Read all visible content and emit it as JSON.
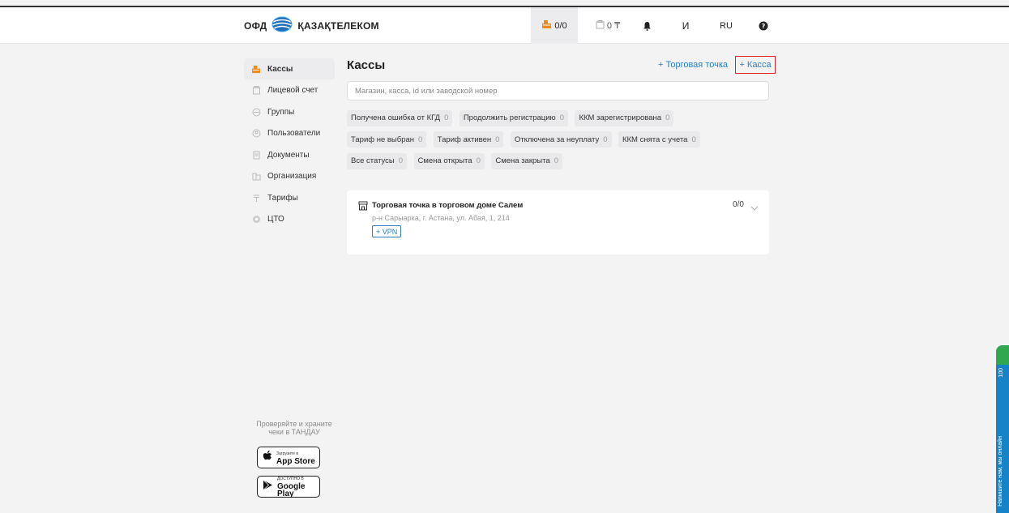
{
  "header": {
    "logo_ofd": "ОФД",
    "logo_name": "ҚАЗАҚТЕЛЕКОМ",
    "kassa_count": "0/0",
    "balance": "0 ₸",
    "user_initial": "И",
    "lang": "RU"
  },
  "sidebar": {
    "items": [
      {
        "label": "Кассы",
        "icon": "cash-register-icon",
        "active": true
      },
      {
        "label": "Лицевой счет",
        "icon": "account-icon"
      },
      {
        "label": "Группы",
        "icon": "groups-icon"
      },
      {
        "label": "Пользователи",
        "icon": "users-icon"
      },
      {
        "label": "Документы",
        "icon": "documents-icon"
      },
      {
        "label": "Организация",
        "icon": "organization-icon"
      },
      {
        "label": "Тарифы",
        "icon": "tariffs-icon"
      },
      {
        "label": "ЦТО",
        "icon": "service-center-icon"
      }
    ],
    "promo_line1": "Проверяйте и храните",
    "promo_line2": "чеки в ТАНДАУ",
    "appstore_small": "Загрузите в",
    "appstore_big": "App Store",
    "gplay_small": "ДОСТУПНО В",
    "gplay_big": "Google Play"
  },
  "main": {
    "title": "Кассы",
    "add_outlet": "+ Торговая точка",
    "add_kassa": "+ Касса",
    "search_placeholder": "Магазин, касса, id или заводской номер",
    "chips": [
      {
        "label": "Получена ошибка от КГД",
        "count": "0"
      },
      {
        "label": "Продолжить регистрацию",
        "count": "0"
      },
      {
        "label": "ККМ зарегистрирована",
        "count": "0"
      },
      {
        "label": "Тариф не выбран",
        "count": "0"
      },
      {
        "label": "Тариф активен",
        "count": "0"
      },
      {
        "label": "Отключена за неуплату",
        "count": "0"
      },
      {
        "label": "ККМ снята с учета",
        "count": "0"
      },
      {
        "label": "Все статусы",
        "count": "0"
      },
      {
        "label": "Смена открыта",
        "count": "0"
      },
      {
        "label": "Смена закрыта",
        "count": "0"
      }
    ]
  },
  "outlet": {
    "title": "Торговая точка в торговом доме Салем",
    "address": "р-н Сарыарка, г. Астана, ул. Абая, 1, 214",
    "vpn": "+ VPN",
    "count": "0/0"
  },
  "float_tab": {
    "text": "Напишите нам, мы онлайн",
    "online": "100"
  },
  "colors": {
    "accent": "#2a7fc6",
    "highlight": "#e0242c",
    "brand_orange": "#f08a1c",
    "tab_blue": "#1583c6",
    "tab_green": "#2fa84f"
  }
}
